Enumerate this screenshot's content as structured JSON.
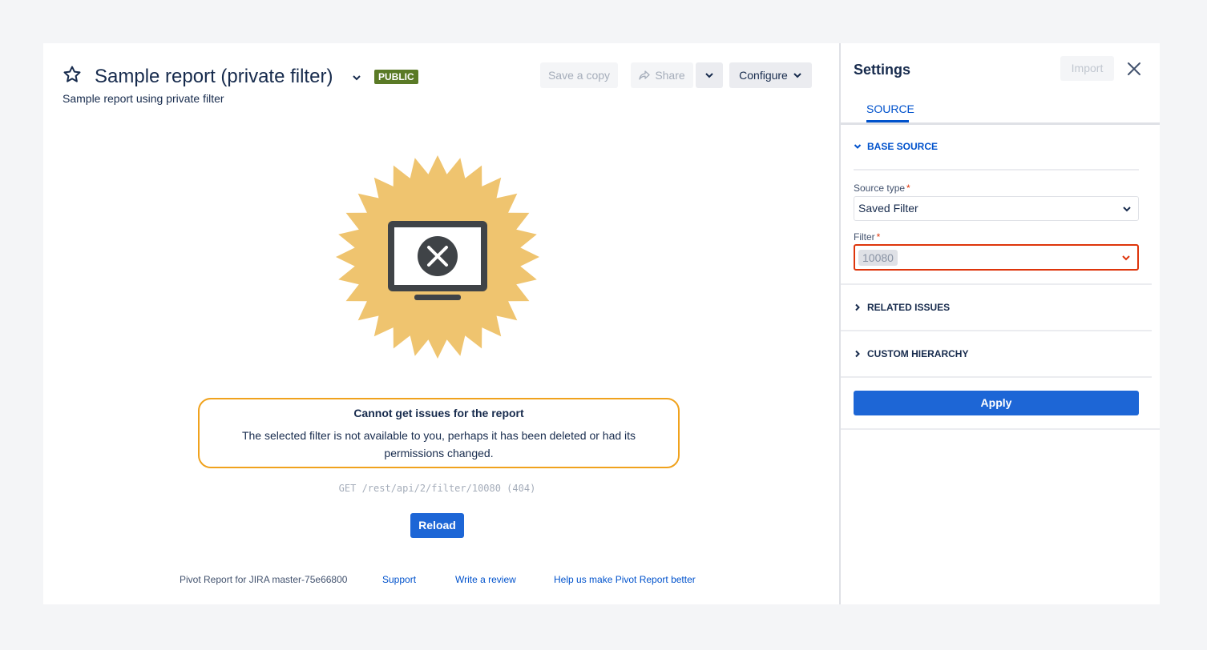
{
  "report": {
    "title": "Sample report (private filter)",
    "badge": "PUBLIC",
    "subtitle": "Sample report using private filter",
    "colors": {
      "badge": "#5a7a26",
      "seal": "#efc46f",
      "error_border": "#f0a21d"
    }
  },
  "toolbar": {
    "save_copy": "Save a copy",
    "share": "Share",
    "configure": "Configure"
  },
  "error": {
    "heading": "Cannot get issues for the report",
    "message": "The selected filter is not available to you, perhaps it has been deleted or had its permissions changed.",
    "request": "GET /rest/api/2/filter/10080 (404)",
    "reload": "Reload",
    "icon": "monitor-error-icon"
  },
  "footer": {
    "version": "Pivot Report for JIRA master-75e66800",
    "support": "Support",
    "review": "Write a review",
    "help": "Help us make Pivot Report better"
  },
  "settings": {
    "title": "Settings",
    "import": "Import",
    "tab": "SOURCE",
    "sections": {
      "base": "BASE SOURCE",
      "related": "RELATED ISSUES",
      "custom": "CUSTOM HIERARCHY"
    },
    "source_type_label": "Source type",
    "source_type_value": "Saved Filter",
    "filter_label": "Filter",
    "filter_value": "10080",
    "required_mark": "*",
    "apply": "Apply",
    "colors": {
      "accent": "#1d66d6",
      "invalid": "#de350b"
    }
  }
}
